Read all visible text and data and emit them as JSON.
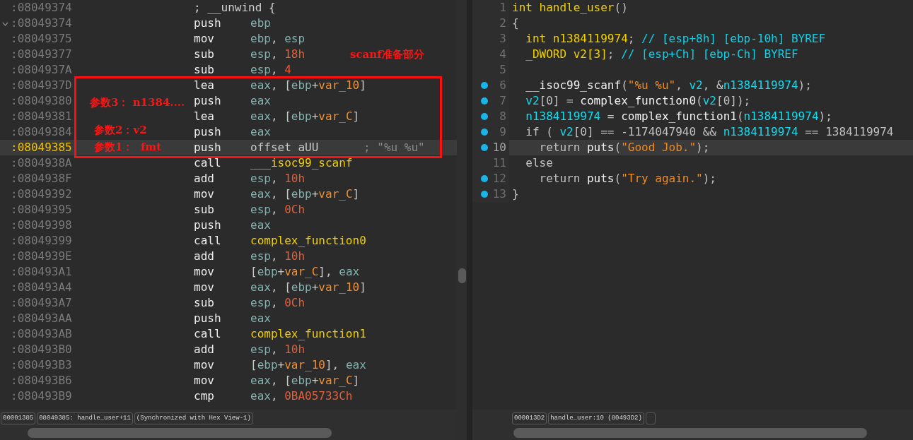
{
  "disassembly": {
    "lines": [
      {
        "kind": "label",
        "address": ":08049374",
        "fold": false,
        "selected": false,
        "text": "; __unwind {"
      },
      {
        "kind": "insn",
        "address": ":08049374",
        "fold": true,
        "selected": false,
        "mnemonic": "push",
        "operands": [
          {
            "kind": "reg",
            "text": "ebp"
          }
        ]
      },
      {
        "kind": "insn",
        "address": ":08049375",
        "fold": false,
        "selected": false,
        "mnemonic": "mov",
        "operands": [
          {
            "kind": "reg",
            "text": "ebp"
          },
          {
            "kind": "plain",
            "text": ", "
          },
          {
            "kind": "reg",
            "text": "esp"
          }
        ]
      },
      {
        "kind": "insn",
        "address": ":08049377",
        "fold": false,
        "selected": false,
        "mnemonic": "sub",
        "operands": [
          {
            "kind": "reg",
            "text": "esp"
          },
          {
            "kind": "plain",
            "text": ", "
          },
          {
            "kind": "num",
            "text": "18h"
          }
        ]
      },
      {
        "kind": "insn",
        "address": ":0804937A",
        "fold": false,
        "selected": false,
        "mnemonic": "sub",
        "operands": [
          {
            "kind": "reg",
            "text": "esp"
          },
          {
            "kind": "plain",
            "text": ", "
          },
          {
            "kind": "num",
            "text": "4"
          }
        ]
      },
      {
        "kind": "insn",
        "address": ":0804937D",
        "fold": false,
        "selected": false,
        "mnemonic": "lea",
        "operands": [
          {
            "kind": "reg",
            "text": "eax"
          },
          {
            "kind": "plain",
            "text": ", ["
          },
          {
            "kind": "reg",
            "text": "ebp"
          },
          {
            "kind": "plain",
            "text": "+"
          },
          {
            "kind": "var",
            "text": "var_10"
          },
          {
            "kind": "plain",
            "text": "]"
          }
        ]
      },
      {
        "kind": "insn",
        "address": ":08049380",
        "fold": false,
        "selected": false,
        "mnemonic": "push",
        "operands": [
          {
            "kind": "reg",
            "text": "eax"
          }
        ]
      },
      {
        "kind": "insn",
        "address": ":08049381",
        "fold": false,
        "selected": false,
        "mnemonic": "lea",
        "operands": [
          {
            "kind": "reg",
            "text": "eax"
          },
          {
            "kind": "plain",
            "text": ", ["
          },
          {
            "kind": "reg",
            "text": "ebp"
          },
          {
            "kind": "plain",
            "text": "+"
          },
          {
            "kind": "var",
            "text": "var_C"
          },
          {
            "kind": "plain",
            "text": "]"
          }
        ]
      },
      {
        "kind": "insn",
        "address": ":08049384",
        "fold": false,
        "selected": false,
        "mnemonic": "push",
        "operands": [
          {
            "kind": "reg",
            "text": "eax"
          }
        ]
      },
      {
        "kind": "insn",
        "address": ":08049385",
        "fold": false,
        "selected": true,
        "mnemonic": "push",
        "operands": [
          {
            "kind": "plain",
            "text": "offset aUU"
          }
        ],
        "comment": "; \"%u %u\""
      },
      {
        "kind": "insn",
        "address": ":0804938A",
        "fold": false,
        "selected": false,
        "mnemonic": "call",
        "operands": [
          {
            "kind": "func",
            "text": "___isoc99_scanf"
          }
        ]
      },
      {
        "kind": "insn",
        "address": ":0804938F",
        "fold": false,
        "selected": false,
        "mnemonic": "add",
        "operands": [
          {
            "kind": "reg",
            "text": "esp"
          },
          {
            "kind": "plain",
            "text": ", "
          },
          {
            "kind": "num",
            "text": "10h"
          }
        ]
      },
      {
        "kind": "insn",
        "address": ":08049392",
        "fold": false,
        "selected": false,
        "mnemonic": "mov",
        "operands": [
          {
            "kind": "reg",
            "text": "eax"
          },
          {
            "kind": "plain",
            "text": ", ["
          },
          {
            "kind": "reg",
            "text": "ebp"
          },
          {
            "kind": "plain",
            "text": "+"
          },
          {
            "kind": "var",
            "text": "var_C"
          },
          {
            "kind": "plain",
            "text": "]"
          }
        ]
      },
      {
        "kind": "insn",
        "address": ":08049395",
        "fold": false,
        "selected": false,
        "mnemonic": "sub",
        "operands": [
          {
            "kind": "reg",
            "text": "esp"
          },
          {
            "kind": "plain",
            "text": ", "
          },
          {
            "kind": "num",
            "text": "0Ch"
          }
        ]
      },
      {
        "kind": "insn",
        "address": ":08049398",
        "fold": false,
        "selected": false,
        "mnemonic": "push",
        "operands": [
          {
            "kind": "reg",
            "text": "eax"
          }
        ]
      },
      {
        "kind": "insn",
        "address": ":08049399",
        "fold": false,
        "selected": false,
        "mnemonic": "call",
        "operands": [
          {
            "kind": "func",
            "text": "complex_function0"
          }
        ]
      },
      {
        "kind": "insn",
        "address": ":0804939E",
        "fold": false,
        "selected": false,
        "mnemonic": "add",
        "operands": [
          {
            "kind": "reg",
            "text": "esp"
          },
          {
            "kind": "plain",
            "text": ", "
          },
          {
            "kind": "num",
            "text": "10h"
          }
        ]
      },
      {
        "kind": "insn",
        "address": ":080493A1",
        "fold": false,
        "selected": false,
        "mnemonic": "mov",
        "operands": [
          {
            "kind": "plain",
            "text": "["
          },
          {
            "kind": "reg",
            "text": "ebp"
          },
          {
            "kind": "plain",
            "text": "+"
          },
          {
            "kind": "var",
            "text": "var_C"
          },
          {
            "kind": "plain",
            "text": "], "
          },
          {
            "kind": "reg",
            "text": "eax"
          }
        ]
      },
      {
        "kind": "insn",
        "address": ":080493A4",
        "fold": false,
        "selected": false,
        "mnemonic": "mov",
        "operands": [
          {
            "kind": "reg",
            "text": "eax"
          },
          {
            "kind": "plain",
            "text": ", ["
          },
          {
            "kind": "reg",
            "text": "ebp"
          },
          {
            "kind": "plain",
            "text": "+"
          },
          {
            "kind": "var",
            "text": "var_10"
          },
          {
            "kind": "plain",
            "text": "]"
          }
        ]
      },
      {
        "kind": "insn",
        "address": ":080493A7",
        "fold": false,
        "selected": false,
        "mnemonic": "sub",
        "operands": [
          {
            "kind": "reg",
            "text": "esp"
          },
          {
            "kind": "plain",
            "text": ", "
          },
          {
            "kind": "num",
            "text": "0Ch"
          }
        ]
      },
      {
        "kind": "insn",
        "address": ":080493AA",
        "fold": false,
        "selected": false,
        "mnemonic": "push",
        "operands": [
          {
            "kind": "reg",
            "text": "eax"
          }
        ]
      },
      {
        "kind": "insn",
        "address": ":080493AB",
        "fold": false,
        "selected": false,
        "mnemonic": "call",
        "operands": [
          {
            "kind": "func",
            "text": "complex_function1"
          }
        ]
      },
      {
        "kind": "insn",
        "address": ":080493B0",
        "fold": false,
        "selected": false,
        "mnemonic": "add",
        "operands": [
          {
            "kind": "reg",
            "text": "esp"
          },
          {
            "kind": "plain",
            "text": ", "
          },
          {
            "kind": "num",
            "text": "10h"
          }
        ]
      },
      {
        "kind": "insn",
        "address": ":080493B3",
        "fold": false,
        "selected": false,
        "mnemonic": "mov",
        "operands": [
          {
            "kind": "plain",
            "text": "["
          },
          {
            "kind": "reg",
            "text": "ebp"
          },
          {
            "kind": "plain",
            "text": "+"
          },
          {
            "kind": "var",
            "text": "var_10"
          },
          {
            "kind": "plain",
            "text": "], "
          },
          {
            "kind": "reg",
            "text": "eax"
          }
        ]
      },
      {
        "kind": "insn",
        "address": ":080493B6",
        "fold": false,
        "selected": false,
        "mnemonic": "mov",
        "operands": [
          {
            "kind": "reg",
            "text": "eax"
          },
          {
            "kind": "plain",
            "text": ", ["
          },
          {
            "kind": "reg",
            "text": "ebp"
          },
          {
            "kind": "plain",
            "text": "+"
          },
          {
            "kind": "var",
            "text": "var_C"
          },
          {
            "kind": "plain",
            "text": "]"
          }
        ]
      },
      {
        "kind": "insn",
        "address": ":080493B9",
        "fold": false,
        "selected": false,
        "mnemonic": "cmp",
        "operands": [
          {
            "kind": "reg",
            "text": "eax"
          },
          {
            "kind": "plain",
            "text": ", "
          },
          {
            "kind": "num",
            "text": "0BA05733Ch"
          }
        ]
      }
    ],
    "annotations": [
      "scanf准备部分",
      "参数3： n1384....",
      "参数2：v2",
      "参数1：  fmt"
    ],
    "status": [
      "00001385",
      "08049385: handle_user+11",
      "(Synchronized with Hex View-1)"
    ]
  },
  "decompiler": {
    "lines": [
      {
        "number": "1",
        "breakpoint": false,
        "selected": false,
        "tokens": [
          {
            "kind": "type",
            "text": "int handle_user"
          },
          {
            "kind": "plain",
            "text": "()"
          }
        ]
      },
      {
        "number": "2",
        "breakpoint": false,
        "selected": false,
        "tokens": [
          {
            "kind": "plain",
            "text": "{"
          }
        ]
      },
      {
        "number": "3",
        "breakpoint": false,
        "selected": false,
        "tokens": [
          {
            "kind": "type",
            "text": "  int n1384119974"
          },
          {
            "kind": "plain",
            "text": "; "
          },
          {
            "kind": "comment",
            "text": "// [esp+8h] [ebp-10h] BYREF"
          }
        ]
      },
      {
        "number": "4",
        "breakpoint": false,
        "selected": false,
        "tokens": [
          {
            "kind": "type",
            "text": "  _DWORD v2[3]"
          },
          {
            "kind": "plain",
            "text": "; "
          },
          {
            "kind": "comment",
            "text": "// [esp+Ch] [ebp-Ch] BYREF"
          }
        ]
      },
      {
        "number": "5",
        "breakpoint": false,
        "selected": false
      },
      {
        "number": "6",
        "breakpoint": true,
        "selected": false,
        "tokens": [
          {
            "kind": "call",
            "text": "  __isoc99_scanf"
          },
          {
            "kind": "plain",
            "text": "("
          },
          {
            "kind": "str",
            "text": "\"%u %u\""
          },
          {
            "kind": "plain",
            "text": ", "
          },
          {
            "kind": "var",
            "text": "v2"
          },
          {
            "kind": "plain",
            "text": ", &"
          },
          {
            "kind": "var",
            "text": "n1384119974"
          },
          {
            "kind": "plain",
            "text": ");"
          }
        ]
      },
      {
        "number": "7",
        "breakpoint": true,
        "selected": false,
        "tokens": [
          {
            "kind": "var",
            "text": "  v2"
          },
          {
            "kind": "plain",
            "text": "[0] = "
          },
          {
            "kind": "call",
            "text": "complex_function0"
          },
          {
            "kind": "plain",
            "text": "("
          },
          {
            "kind": "var",
            "text": "v2"
          },
          {
            "kind": "plain",
            "text": "[0]);"
          }
        ]
      },
      {
        "number": "8",
        "breakpoint": true,
        "selected": false,
        "tokens": [
          {
            "kind": "var",
            "text": "  n1384119974"
          },
          {
            "kind": "plain",
            "text": " = "
          },
          {
            "kind": "call",
            "text": "complex_function1"
          },
          {
            "kind": "plain",
            "text": "("
          },
          {
            "kind": "var",
            "text": "n1384119974"
          },
          {
            "kind": "plain",
            "text": ");"
          }
        ]
      },
      {
        "number": "9",
        "breakpoint": true,
        "selected": false,
        "tokens": [
          {
            "kind": "plain",
            "text": "  if ( "
          },
          {
            "kind": "var",
            "text": "v2"
          },
          {
            "kind": "plain",
            "text": "[0] == -1174047940 && "
          },
          {
            "kind": "var",
            "text": "n1384119974"
          },
          {
            "kind": "plain",
            "text": " == 1384119974"
          }
        ]
      },
      {
        "number": "10",
        "breakpoint": true,
        "selected": true,
        "tokens": [
          {
            "kind": "plain",
            "text": "    return "
          },
          {
            "kind": "call",
            "text": "puts"
          },
          {
            "kind": "plain",
            "text": "("
          },
          {
            "kind": "str",
            "text": "\"Good Job.\""
          },
          {
            "kind": "plain",
            "text": ");"
          }
        ]
      },
      {
        "number": "11",
        "breakpoint": false,
        "selected": false,
        "tokens": [
          {
            "kind": "plain",
            "text": "  else"
          }
        ]
      },
      {
        "number": "12",
        "breakpoint": true,
        "selected": false,
        "tokens": [
          {
            "kind": "plain",
            "text": "    return "
          },
          {
            "kind": "call",
            "text": "puts"
          },
          {
            "kind": "plain",
            "text": "("
          },
          {
            "kind": "str",
            "text": "\"Try again.\""
          },
          {
            "kind": "plain",
            "text": ");"
          }
        ]
      },
      {
        "number": "13",
        "breakpoint": true,
        "selected": false,
        "tokens": [
          {
            "kind": "plain",
            "text": "}"
          }
        ]
      }
    ],
    "status": [
      "000013D2",
      "handle_user:10 (80493D2)"
    ]
  }
}
